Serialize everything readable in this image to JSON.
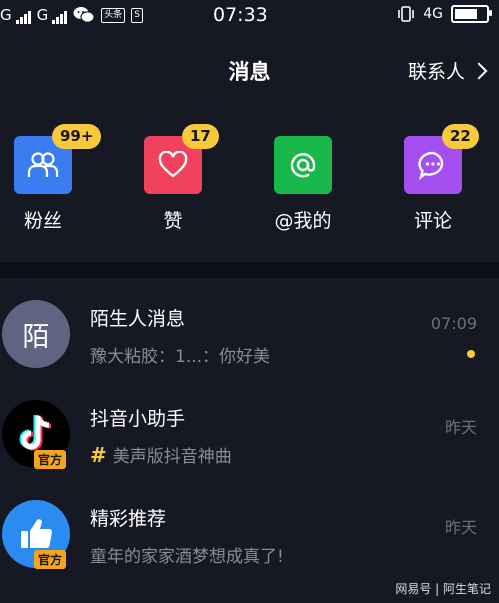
{
  "status_bar": {
    "network1": "G",
    "network2": "G",
    "notif_label": "头条",
    "time": "07:33",
    "network_type": "4G",
    "battery_level": 0.85
  },
  "header": {
    "title": "消息",
    "contacts_label": "联系人"
  },
  "quick_actions": [
    {
      "label": "粉丝",
      "badge": "99+",
      "icon": "fans-icon",
      "color": "#3b7cf0"
    },
    {
      "label": "赞",
      "badge": "17",
      "icon": "heart-icon",
      "color": "#f0425c"
    },
    {
      "label": "@我的",
      "badge": "",
      "icon": "at-icon",
      "color": "#18b84a"
    },
    {
      "label": "评论",
      "badge": "22",
      "icon": "comment-icon",
      "color": "#a64ff0"
    }
  ],
  "messages": [
    {
      "title": "陌生人消息",
      "preview": "豫大粘胶：1...：你好美",
      "time": "07:09",
      "avatar_text": "陌",
      "unread": true
    },
    {
      "title": "抖音小助手",
      "preview": "美声版抖音神曲",
      "time": "昨天",
      "official": "官方"
    },
    {
      "title": "精彩推荐",
      "preview": "童年的家家酒梦想成真了!",
      "time": "昨天",
      "official": "官方"
    }
  ],
  "watermark": "网易号 | 阿生笔记"
}
